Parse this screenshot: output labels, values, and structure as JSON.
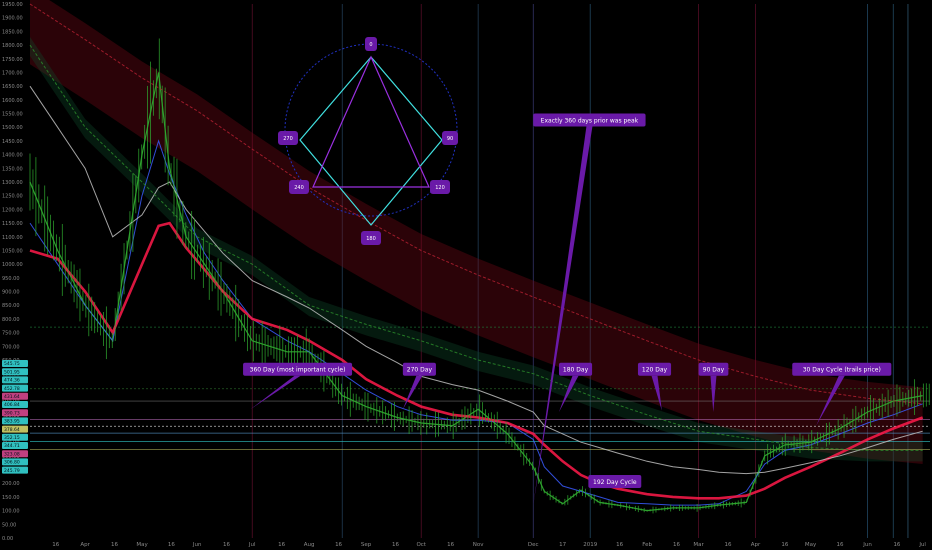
{
  "chart_data": {
    "type": "line",
    "title": "",
    "xlabel": "",
    "ylabel": "",
    "ylim": [
      0,
      1950
    ],
    "y_ticks": [
      "1950.00",
      "1900.00",
      "1850.00",
      "1800.00",
      "1750.00",
      "1700.00",
      "1650.00",
      "1600.00",
      "1550.00",
      "1500.00",
      "1450.00",
      "1400.00",
      "1350.00",
      "1300.00",
      "1250.00",
      "1200.00",
      "1150.00",
      "1100.00",
      "1050.00",
      "1000.00",
      "950.00",
      "900.00",
      "850.00",
      "800.00",
      "750.00",
      "700.00",
      "650.00",
      "600.00",
      "550.00",
      "500.00",
      "450.00",
      "400.00",
      "350.00",
      "300.00",
      "250.00",
      "200.00",
      "150.00",
      "100.00",
      "50.00",
      "0.00"
    ],
    "x_ticks": [
      "16",
      "Apr",
      "16",
      "May",
      "16",
      "Jun",
      "16",
      "Jul",
      "16",
      "Aug",
      "16",
      "Sep",
      "16",
      "Oct",
      "16",
      "Nov",
      "Dec",
      "17",
      "2019",
      "16",
      "Feb",
      "16",
      "Mar",
      "16",
      "Apr",
      "16",
      "May",
      "16",
      "Jun",
      "16",
      "Jul"
    ],
    "x_tick_index": [
      14,
      30,
      46,
      61,
      77,
      91,
      107,
      121,
      137,
      152,
      168,
      183,
      199,
      213,
      229,
      244,
      274,
      290,
      305,
      321,
      336,
      352,
      364,
      380,
      395,
      411,
      425,
      441,
      456,
      472,
      486
    ],
    "y_tick_labels_left": [
      "545.75",
      "501.95",
      "474.36",
      "452.78",
      "431.64",
      "406.84",
      "390.73",
      "383.95",
      "378.64",
      "352.15",
      "344.71",
      "323.08",
      "306.80",
      "245.79"
    ],
    "series": [
      {
        "name": "",
        "color": "#2fa82f",
        "x": [
          0,
          15,
          30,
          45,
          61,
          70,
          76,
          85,
          95,
          105,
          121,
          140,
          152,
          170,
          183,
          200,
          213,
          230,
          244,
          260,
          274,
          280,
          290,
          300,
          310,
          320,
          336,
          350,
          364,
          375,
          390,
          400,
          411,
          425,
          441,
          456,
          470,
          486
        ],
        "values": [
          1300,
          1050,
          850,
          720,
          1400,
          1700,
          1350,
          1100,
          1000,
          900,
          720,
          680,
          680,
          520,
          480,
          440,
          420,
          410,
          470,
          380,
          260,
          170,
          125,
          175,
          130,
          120,
          100,
          110,
          110,
          120,
          130,
          300,
          340,
          350,
          400,
          460,
          500,
          520
        ]
      },
      {
        "name": "",
        "color": "#3a5cff",
        "x": [
          0,
          15,
          30,
          45,
          61,
          70,
          76,
          85,
          95,
          105,
          121,
          140,
          152,
          170,
          183,
          200,
          213,
          230,
          244,
          260,
          274,
          280,
          290,
          300,
          310,
          320,
          336,
          350,
          364,
          375,
          390,
          400,
          411,
          425,
          441,
          456,
          470,
          486
        ],
        "values": [
          1150,
          1000,
          850,
          720,
          1250,
          1450,
          1330,
          1180,
          1040,
          940,
          800,
          720,
          680,
          600,
          540,
          480,
          450,
          430,
          430,
          420,
          360,
          260,
          190,
          170,
          150,
          130,
          125,
          120,
          120,
          125,
          170,
          270,
          320,
          340,
          380,
          420,
          450,
          490
        ]
      },
      {
        "name": "",
        "color": "#ff1a4a",
        "x": [
          0,
          15,
          30,
          45,
          61,
          70,
          76,
          85,
          95,
          105,
          121,
          140,
          152,
          170,
          183,
          200,
          213,
          230,
          244,
          260,
          274,
          280,
          290,
          300,
          310,
          320,
          336,
          350,
          364,
          375,
          390,
          400,
          411,
          425,
          441,
          456,
          470,
          486
        ],
        "values": [
          1050,
          1020,
          900,
          750,
          1000,
          1140,
          1150,
          1060,
          980,
          900,
          800,
          760,
          720,
          650,
          580,
          520,
          480,
          450,
          440,
          420,
          380,
          340,
          280,
          230,
          200,
          180,
          160,
          150,
          145,
          145,
          155,
          180,
          220,
          260,
          310,
          360,
          400,
          440
        ]
      },
      {
        "name": "",
        "color": "#c0c0c0",
        "x": [
          0,
          15,
          30,
          45,
          61,
          70,
          76,
          85,
          95,
          105,
          121,
          140,
          152,
          170,
          183,
          200,
          213,
          230,
          244,
          260,
          274,
          280,
          290,
          300,
          310,
          320,
          336,
          350,
          364,
          375,
          390,
          400,
          411,
          425,
          441,
          456,
          470,
          486
        ],
        "values": [
          1650,
          1500,
          1350,
          1100,
          1180,
          1280,
          1300,
          1200,
          1120,
          1040,
          940,
          880,
          840,
          760,
          700,
          640,
          590,
          560,
          540,
          500,
          460,
          410,
          380,
          350,
          330,
          310,
          280,
          260,
          250,
          240,
          235,
          240,
          255,
          275,
          300,
          330,
          360,
          390
        ]
      },
      {
        "name": "",
        "color": "#2a8a2a",
        "x": [
          0,
          30,
          61,
          91,
          121,
          152,
          183,
          213,
          244,
          274,
          305,
          336,
          364,
          395,
          425,
          456,
          486
        ],
        "values": [
          1800,
          1500,
          1300,
          1100,
          1000,
          850,
          780,
          720,
          650,
          600,
          520,
          450,
          390,
          360,
          330,
          320,
          320
        ]
      },
      {
        "name": "",
        "color": "#b02030",
        "x": [
          0,
          30,
          61,
          91,
          121,
          152,
          183,
          213,
          244,
          274,
          305,
          336,
          364,
          395,
          425,
          456,
          486
        ],
        "values": [
          1950,
          1820,
          1680,
          1560,
          1420,
          1280,
          1160,
          1050,
          960,
          880,
          800,
          720,
          650,
          590,
          540,
          510,
          490
        ]
      }
    ],
    "horizontal_levels": [
      {
        "value": 770,
        "color": "#1e7a3a",
        "style": "dashed"
      },
      {
        "value": 545,
        "color": "#2a6a2a",
        "style": "dashed"
      },
      {
        "value": 500,
        "color": "#7a7a7a",
        "style": "solid"
      },
      {
        "value": 432,
        "color": "#c070c0",
        "style": "solid"
      },
      {
        "value": 408,
        "color": "#e0e0e0",
        "style": "dashed"
      },
      {
        "value": 383,
        "color": "#5090c0",
        "style": "solid"
      },
      {
        "value": 352,
        "color": "#30c0c0",
        "style": "solid"
      },
      {
        "value": 323,
        "color": "#c0c060",
        "style": "solid"
      }
    ],
    "annotations": [
      {
        "text": "360 Day (most important cycle)",
        "x": 116,
        "y": 640,
        "point_x": 120,
        "point_y": 470
      },
      {
        "text": "270 Day",
        "x": 203,
        "y": 640,
        "point_x": 203,
        "point_y": 470
      },
      {
        "text": "Exactly 360 days prior was peak",
        "x": 274,
        "y": 1550,
        "point_x": 274,
        "point_y": 120
      },
      {
        "text": "180 Day",
        "x": 288,
        "y": 640,
        "point_x": 288,
        "point_y": 460
      },
      {
        "text": "120 Day",
        "x": 331,
        "y": 640,
        "point_x": 344,
        "point_y": 465
      },
      {
        "text": "90 Day",
        "x": 364,
        "y": 640,
        "point_x": 372,
        "point_y": 460
      },
      {
        "text": "30 Day Cycle (trails price)",
        "x": 415,
        "y": 640,
        "point_x": 428,
        "point_y": 410
      },
      {
        "text": "192 Day Cycle",
        "x": 304,
        "y": 230,
        "point_x": 282,
        "point_y": 180
      }
    ],
    "cycle_diagram": {
      "labels": [
        "0",
        "90",
        "120",
        "180",
        "240",
        "270"
      ]
    },
    "grid": false,
    "legend": "none"
  }
}
